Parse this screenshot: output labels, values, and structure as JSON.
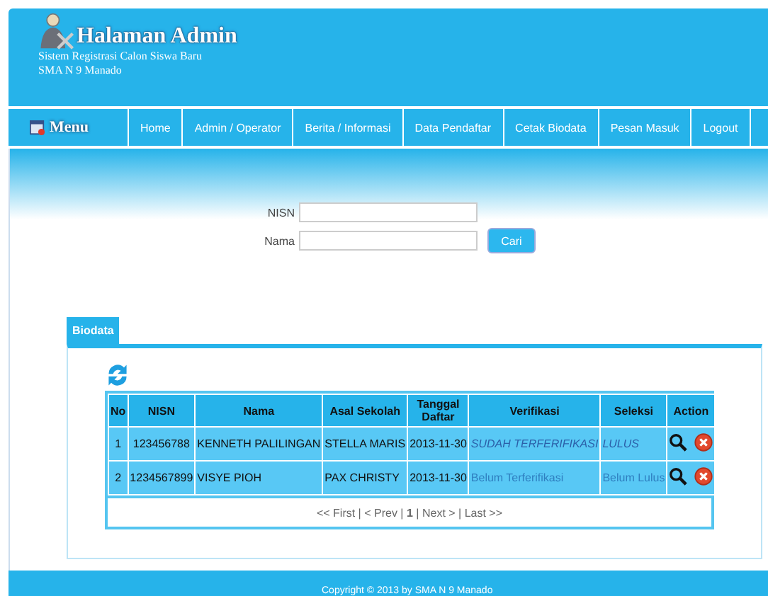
{
  "header": {
    "title": "Halaman Admin",
    "subtitle_lines": [
      "Sistem Registrasi Calon Siswa Baru",
      "SMA N 9 Manado"
    ]
  },
  "nav": {
    "menu_label": "Menu",
    "items": [
      {
        "label": "Home"
      },
      {
        "label": "Admin / Operator"
      },
      {
        "label": "Berita / Informasi"
      },
      {
        "label": "Data Pendaftar"
      },
      {
        "label": "Cetak Biodata"
      },
      {
        "label": "Pesan Masuk"
      },
      {
        "label": "Logout"
      }
    ]
  },
  "search": {
    "fields": [
      {
        "label": "NISN"
      },
      {
        "label": "Nama"
      }
    ],
    "button": "Cari"
  },
  "panel": {
    "tab": "Biodata",
    "table": {
      "columns": [
        "No",
        "NISN",
        "Nama",
        "Asal Sekolah",
        "Tanggal Daftar",
        "Verifikasi",
        "Seleksi",
        "Action"
      ],
      "rows": [
        {
          "no": "1",
          "nisn": "123456788",
          "nama": "KENNETH PALILINGAN",
          "asal": "STELLA MARIS",
          "tanggal": "2013-11-30",
          "verifikasi": "SUDAH TERFERIFIKASI",
          "verified": true,
          "seleksi": "LULUS",
          "passed": true
        },
        {
          "no": "2",
          "nisn": "1234567899",
          "nama": "VISYE PIOH",
          "asal": "PAX CHRISTY",
          "tanggal": "2013-11-30",
          "verifikasi": "Belum Terferifikasi",
          "verified": false,
          "seleksi": "Belum Lulus",
          "passed": false
        }
      ]
    },
    "pagination": "<< First | < Prev | **1** | Next > | Last >>"
  },
  "footer": "Copyright © 2013 by SMA N 9 Manado"
}
